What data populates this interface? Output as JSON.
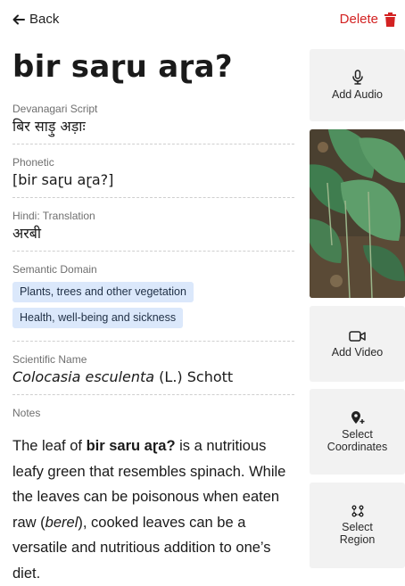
{
  "header": {
    "back_label": "Back",
    "delete_label": "Delete"
  },
  "entry": {
    "title": "bir saɽu aɽa?",
    "fields": {
      "devanagari": {
        "label": "Devanagari Script",
        "value": "बिर साड़ु अड़ाः"
      },
      "phonetic": {
        "label": "Phonetic",
        "value": "[bir saɽu aɽa?]"
      },
      "translation": {
        "label": "Hindi: Translation",
        "value": "अरबी"
      },
      "semantic": {
        "label": "Semantic Domain",
        "chips": [
          "Plants, trees and other vegetation",
          "Health, well-being and sickness"
        ]
      },
      "scientific": {
        "label": "Scientific Name",
        "genus_species": "Colocasia esculenta",
        "authority": " (L.) Schott"
      }
    },
    "notes": {
      "label": "Notes",
      "text_1": "The leaf of ",
      "bold": "bir saru aɽa?",
      "text_2": " is a nutritious leafy green that resembles spinach. While the leaves can be poisonous when eaten raw (",
      "italic": "berel",
      "text_3": "), cooked leaves can be a versatile and nutritious addition to one’s diet."
    }
  },
  "sidebar": {
    "add_audio": "Add Audio",
    "add_video": "Add Video",
    "select_coordinates_1": "Select",
    "select_coordinates_2": "Coordinates",
    "select_region_1": "Select",
    "select_region_2": "Region",
    "icons": {
      "audio": "microphone-icon",
      "video": "video-camera-icon",
      "coordinates": "map-pin-plus-icon",
      "region": "region-icon"
    }
  },
  "colors": {
    "delete": "#d32222",
    "chip_bg": "#dbe8fb",
    "side_bg": "#f2f2f2"
  }
}
